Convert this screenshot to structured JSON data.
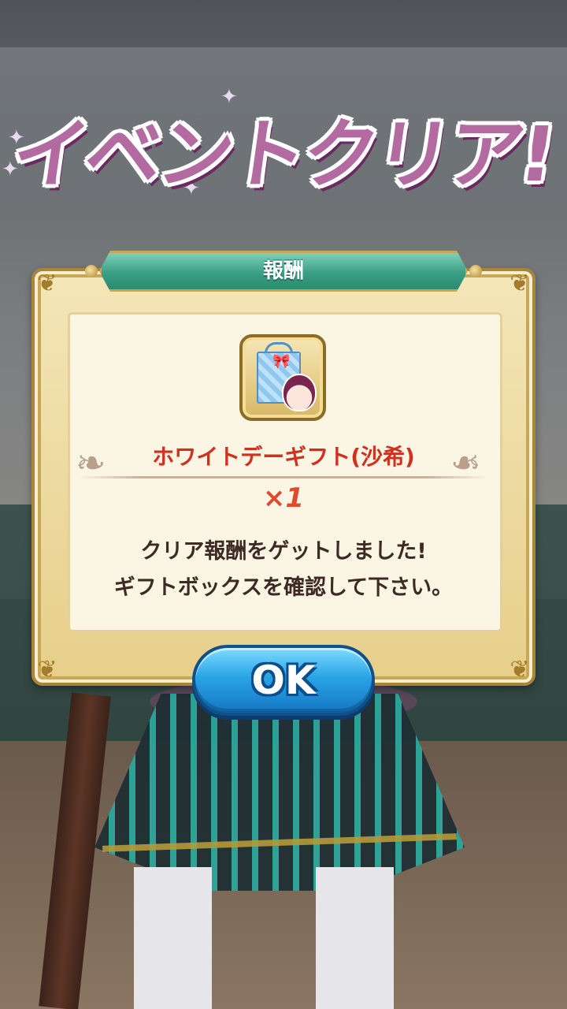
{
  "title": "イベントクリア!",
  "dialog": {
    "header": "報酬",
    "item": {
      "icon": "gift-bag-icon",
      "name": "ホワイトデーギフト(沙希)",
      "quantity": "×1"
    },
    "message_line1": "クリア報酬をゲットしました!",
    "message_line2": "ギフトボックスを確認して下さい。"
  },
  "ok_button": {
    "label": "OK"
  },
  "colors": {
    "title": "#b26aa0",
    "header_bar": "#3a9f85",
    "item_name": "#d0311e",
    "ok_button": "#2aa4e6"
  }
}
